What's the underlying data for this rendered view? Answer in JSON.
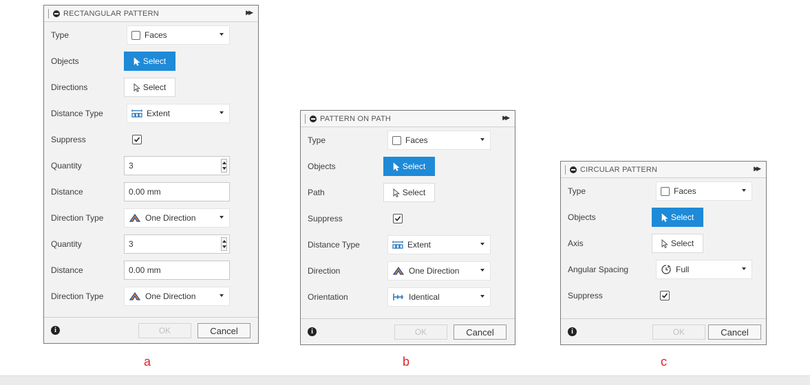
{
  "colors": {
    "accent": "#1e8ad8",
    "caption": "#e0232b"
  },
  "dialogs": [
    {
      "title": "RECTANGULAR PATTERN",
      "rows": {
        "type": {
          "label": "Type",
          "value": "Faces"
        },
        "objects": {
          "label": "Objects",
          "value": "Select"
        },
        "directions": {
          "label": "Directions",
          "value": "Select"
        },
        "distance_type": {
          "label": "Distance Type",
          "value": "Extent"
        },
        "suppress": {
          "label": "Suppress",
          "checked": true
        },
        "quantity1": {
          "label": "Quantity",
          "value": "3"
        },
        "distance1": {
          "label": "Distance",
          "value": "0.00 mm"
        },
        "direction_type1": {
          "label": "Direction Type",
          "value": "One Direction"
        },
        "quantity2": {
          "label": "Quantity",
          "value": "3"
        },
        "distance2": {
          "label": "Distance",
          "value": "0.00 mm"
        },
        "direction_type2": {
          "label": "Direction Type",
          "value": "One Direction"
        }
      },
      "ok": "OK",
      "cancel": "Cancel",
      "caption": "a"
    },
    {
      "title": "PATTERN ON PATH",
      "rows": {
        "type": {
          "label": "Type",
          "value": "Faces"
        },
        "objects": {
          "label": "Objects",
          "value": "Select"
        },
        "path": {
          "label": "Path",
          "value": "Select"
        },
        "suppress": {
          "label": "Suppress",
          "checked": true
        },
        "distance_type": {
          "label": "Distance Type",
          "value": "Extent"
        },
        "direction": {
          "label": "Direction",
          "value": "One Direction"
        },
        "orientation": {
          "label": "Orientation",
          "value": "Identical"
        }
      },
      "ok": "OK",
      "cancel": "Cancel",
      "caption": "b"
    },
    {
      "title": "CIRCULAR PATTERN",
      "rows": {
        "type": {
          "label": "Type",
          "value": "Faces"
        },
        "objects": {
          "label": "Objects",
          "value": "Select"
        },
        "axis": {
          "label": "Axis",
          "value": "Select"
        },
        "angular_spacing": {
          "label": "Angular Spacing",
          "value": "Full"
        },
        "suppress": {
          "label": "Suppress",
          "checked": true
        }
      },
      "ok": "OK",
      "cancel": "Cancel",
      "caption": "c"
    }
  ]
}
